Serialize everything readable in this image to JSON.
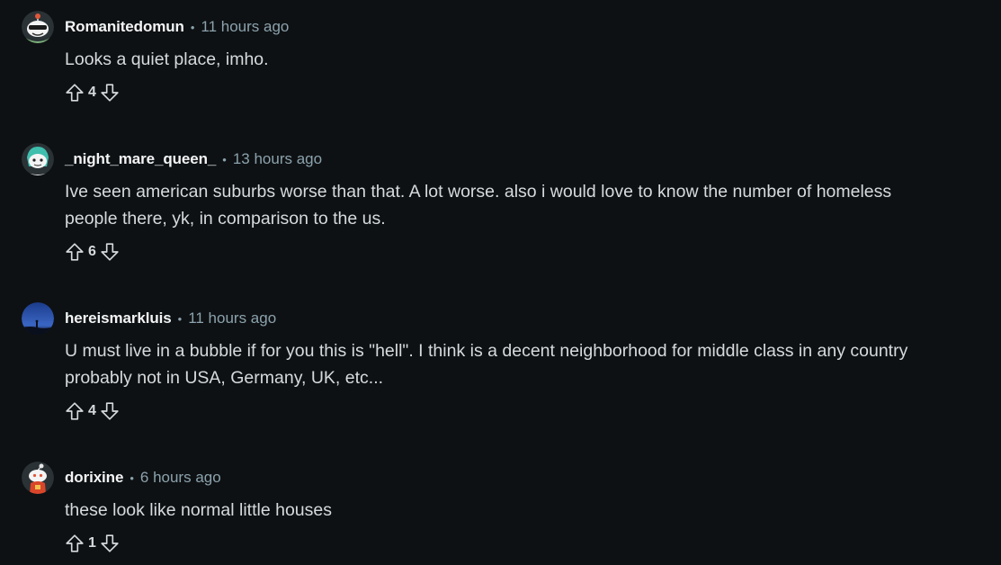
{
  "comments": [
    {
      "author": "Romanitedomun",
      "separator": "•",
      "time": "11 hours ago",
      "body": "Looks a quiet place, imho.",
      "score": "4",
      "avatar_icon": "snoo-sunglasses-avatar-icon"
    },
    {
      "author": "_night_mare_queen_",
      "separator": "•",
      "time": "13 hours ago",
      "body": "Ive seen american suburbs worse than that. A lot worse. also i would love to know the number of homeless\npeople there, yk, in comparison to the us.",
      "score": "6",
      "avatar_icon": "snoo-teal-hair-avatar-icon"
    },
    {
      "author": "hereismarkluis",
      "separator": "•",
      "time": "11 hours ago",
      "body": "U must live in a bubble if for you this is \"hell\". I think is a decent neighborhood for middle class in any country\nprobably not in USA, Germany, UK, etc...",
      "score": "4",
      "avatar_icon": "night-sky-photo-avatar-icon"
    },
    {
      "author": "dorixine",
      "separator": "•",
      "time": "6 hours ago",
      "body": "these look like normal little houses",
      "score": "1",
      "avatar_icon": "snoo-default-avatar-icon"
    }
  ],
  "colors": {
    "background": "#0e1113",
    "author": "#f2f4f5",
    "meta": "#8ba2ad",
    "body": "#d7dadc"
  }
}
